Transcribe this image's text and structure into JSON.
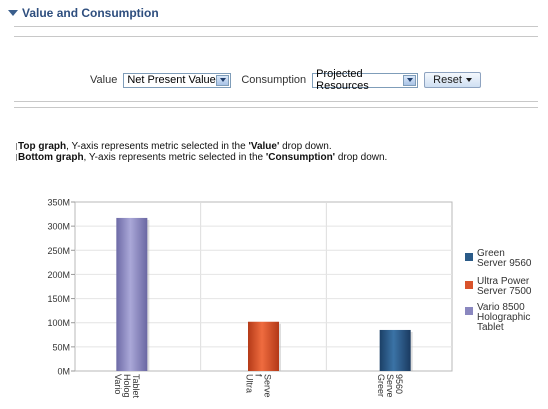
{
  "header": {
    "title": "Value and Consumption"
  },
  "controls": {
    "value_label": "Value",
    "value_selected": "Net Present Value",
    "consumption_label": "Consumption",
    "consumption_selected": "Projected Resources",
    "reset_label": "Reset"
  },
  "description": {
    "line1_bold": "Top graph",
    "line1_pre": ", Y-axis represents metric selected in the ",
    "line1_quoted": "'Value'",
    "line1_post": " drop down.",
    "line2_bold": "Bottom graph",
    "line2_pre": ", Y-axis represents metric selected in the ",
    "line2_quoted": "'Consumption'",
    "line2_post": " drop down."
  },
  "chart_data": {
    "type": "bar",
    "categories": [
      "Vario Holog Tablet",
      "Ultra f Serve",
      "Greer Serve 9560"
    ],
    "series": [
      {
        "name": "Green Server 9560",
        "color": "#2b5b88",
        "values": [
          null,
          null,
          85
        ]
      },
      {
        "name": "Ultra Power Server 7500",
        "color": "#d9532b",
        "values": [
          null,
          102,
          null
        ]
      },
      {
        "name": "Vario 8500 Holographic Tablet",
        "color": "#8a87bf",
        "values": [
          317,
          null,
          null
        ]
      }
    ],
    "y_ticks": [
      "0M",
      "50M",
      "100M",
      "150M",
      "200M",
      "250M",
      "300M",
      "350M"
    ],
    "ylim": [
      0,
      350
    ],
    "unit": "M",
    "grid": true,
    "legend_position": "right"
  }
}
